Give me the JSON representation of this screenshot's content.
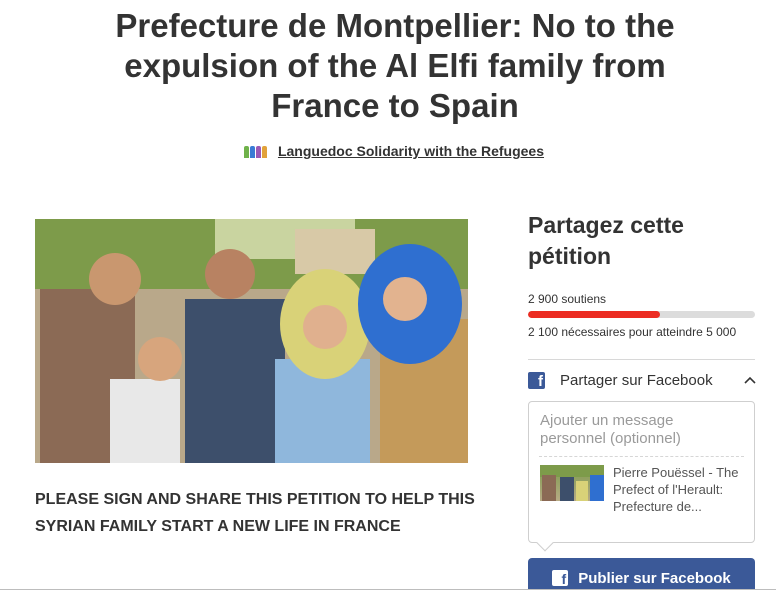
{
  "petition": {
    "title": "Prefecture de Montpellier: No to the expulsion of the Al Elfi family from France to Spain",
    "organization": "Languedoc Solidarity with the Refugees",
    "lead": "PLEASE SIGN AND SHARE THIS PETITION TO HELP THIS SYRIAN FAMILY START A NEW LIFE IN FRANCE"
  },
  "sidebar": {
    "share_title": "Partagez cette pétition",
    "supporters": "2 900 soutiens",
    "progress_fraction": 0.58,
    "needed": "2 100 nécessaires pour atteindre 5 000",
    "facebook_share_label": "Partager sur Facebook",
    "message_placeholder": "Ajouter un message personnel (optionnel)",
    "preview_text": "Pierre Pouëssel - The Prefect of l'Herault: Prefecture de...",
    "publish_label": "Publier sur Facebook"
  },
  "icons": {
    "facebook": "facebook-icon",
    "chevron": "chevron-up-icon"
  },
  "colors": {
    "progress": "#ec2c22",
    "facebook": "#3b5998"
  }
}
